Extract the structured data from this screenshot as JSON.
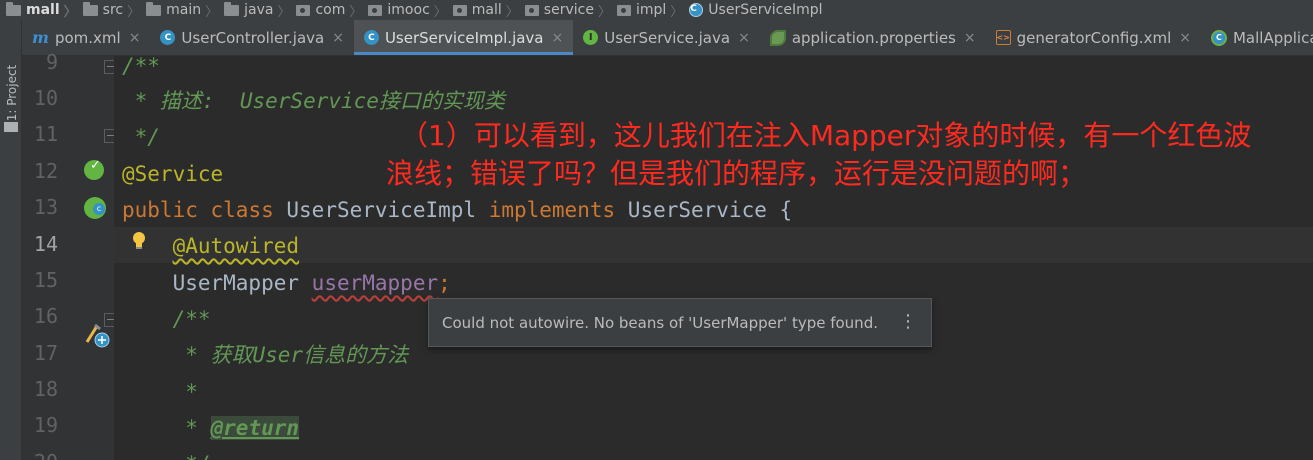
{
  "breadcrumb": [
    {
      "label": "mall",
      "icon": "module-icon"
    },
    {
      "label": "src",
      "icon": "folder-icon"
    },
    {
      "label": "main",
      "icon": "folder-icon"
    },
    {
      "label": "java",
      "icon": "folder-icon"
    },
    {
      "label": "com",
      "icon": "package-icon"
    },
    {
      "label": "imooc",
      "icon": "package-icon"
    },
    {
      "label": "mall",
      "icon": "package-icon"
    },
    {
      "label": "service",
      "icon": "package-icon"
    },
    {
      "label": "impl",
      "icon": "package-icon"
    },
    {
      "label": "UserServiceImpl",
      "icon": "class-icon"
    }
  ],
  "tool_window": {
    "project_label": "1: Project"
  },
  "tabs": [
    {
      "label": "pom.xml",
      "icon": "maven-icon",
      "active": false
    },
    {
      "label": "UserController.java",
      "icon": "class-icon",
      "active": false
    },
    {
      "label": "UserServiceImpl.java",
      "icon": "class-icon",
      "active": true
    },
    {
      "label": "UserService.java",
      "icon": "interface-icon",
      "active": false
    },
    {
      "label": "application.properties",
      "icon": "spring-properties-icon",
      "active": false
    },
    {
      "label": "generatorConfig.xml",
      "icon": "xml-icon",
      "active": false
    },
    {
      "label": "MallApplication",
      "icon": "spring-boot-app-icon",
      "active": false
    }
  ],
  "tab_close_glyph": "×",
  "editor": {
    "current_line": 14,
    "lines": [
      {
        "number": "9",
        "code": "/**"
      },
      {
        "number": "10",
        "code": " * 描述:  UserService接口的实现类"
      },
      {
        "number": "11",
        "code": " */"
      },
      {
        "number": "12",
        "code": "@Service"
      },
      {
        "number": "13",
        "code": "public class UserServiceImpl implements UserService {"
      },
      {
        "number": "14",
        "code": "    @Autowired"
      },
      {
        "number": "15",
        "code": "    UserMapper userMapper;"
      },
      {
        "number": "16",
        "code": "    /**"
      },
      {
        "number": "17",
        "code": "     * 获取User信息的方法"
      },
      {
        "number": "18",
        "code": "     *"
      },
      {
        "number": "19",
        "code": "     * @return"
      },
      {
        "number": "20",
        "code": "     */"
      }
    ],
    "tokens": {
      "l9": "/**",
      "l10": " * 描述:  UserService接口的实现类",
      "l11": " */",
      "l12": "@Service",
      "l13_kw1": "public",
      "l13_kw2": "class",
      "l13_name": "UserServiceImpl",
      "l13_kw3": "implements",
      "l13_iface": "UserService {",
      "l14_ann": "@Autowired",
      "l15_type": "UserMapper",
      "l15_field": "userMapper",
      "l15_semi": ";",
      "l16": "/**",
      "l17": " * 获取User信息的方法",
      "l18": " *",
      "l19_star": " * ",
      "l19_tag": "@return",
      "l20": " */"
    }
  },
  "annotation": {
    "line1": "（1）可以看到，这儿我们在注入Mapper对象的时候，有一个红色波",
    "line2": "浪线；错误了吗？但是我们的程序，运行是没问题的啊；",
    "color": "#ff2a1f"
  },
  "tooltip": {
    "message": "Could not autowire. No beans of 'UserMapper' type found.",
    "more_glyph": "⋮"
  },
  "colors": {
    "editor_bg": "#2b2b2b",
    "gutter_bg": "#313335",
    "tab_accent": "#4a88c7",
    "comment": "#629755",
    "annotation": "#bbb529",
    "keyword": "#cc7832",
    "field": "#9876aa",
    "error_squiggle": "#bc3f3c"
  }
}
